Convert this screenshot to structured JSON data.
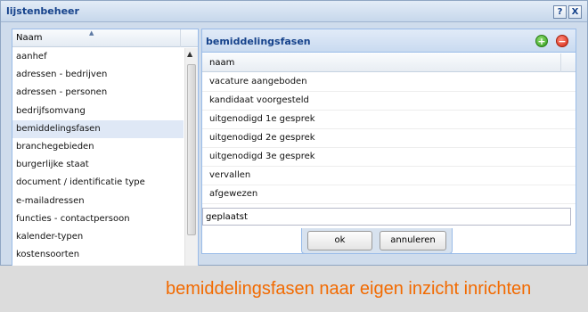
{
  "window": {
    "title": "lijstenbeheer",
    "help_glyph": "?",
    "close_glyph": "X"
  },
  "left_list": {
    "column_header": "Naam",
    "sort_glyph": "▲",
    "scroll_up_glyph": "▲",
    "items": [
      "aanhef",
      "adressen - bedrijven",
      "adressen - personen",
      "bedrijfsomvang",
      "bemiddelingsfasen",
      "branchegebieden",
      "burgerlijke staat",
      "document / identificatie type",
      "e-mailadressen",
      "functies - contactpersoon",
      "kalender-typen",
      "kostensoorten"
    ],
    "selected": "bemiddelingsfasen"
  },
  "right_panel": {
    "title": "bemiddelingsfasen",
    "add_glyph": "+",
    "remove_glyph": "−",
    "column_header": "naam",
    "rows": [
      "vacature aangeboden",
      "kandidaat voorgesteld",
      "uitgenodigd 1e gesprek",
      "uitgenodigd 2e gesprek",
      "uitgenodigd 3e gesprek",
      "vervallen",
      "afgewezen"
    ],
    "edit_value": "geplaatst"
  },
  "buttons": {
    "ok": "ok",
    "cancel": "annuleren"
  },
  "caption": "bemiddelingsfasen naar eigen inzicht inrichten",
  "colors": {
    "accent": "#15428b",
    "caption": "#f26a00",
    "selection": "#dfe8f6"
  }
}
